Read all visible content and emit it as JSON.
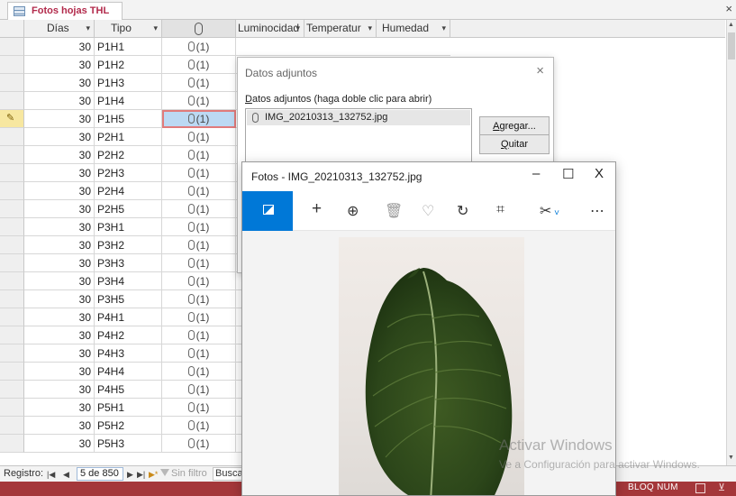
{
  "document_tab": {
    "title": "Fotos hojas THL",
    "close": "×"
  },
  "columns": [
    {
      "label": "Días",
      "dropdown": "▾"
    },
    {
      "label": "Tipo",
      "dropdown": "▾"
    },
    {
      "label": "",
      "icon": "paperclip-icon"
    },
    {
      "label": "Luminocidad",
      "dropdown": "▾"
    },
    {
      "label": "Temperatur",
      "dropdown": "▾"
    },
    {
      "label": "Humedad",
      "dropdown": "▾"
    }
  ],
  "rows": [
    {
      "dias": "30",
      "tipo": "P1H1",
      "adjuntos": "(1)"
    },
    {
      "dias": "30",
      "tipo": "P1H2",
      "adjuntos": "(1)"
    },
    {
      "dias": "30",
      "tipo": "P1H3",
      "adjuntos": "(1)"
    },
    {
      "dias": "30",
      "tipo": "P1H4",
      "adjuntos": "(1)"
    },
    {
      "dias": "30",
      "tipo": "P1H5",
      "adjuntos": "(1)"
    },
    {
      "dias": "30",
      "tipo": "P2H1",
      "adjuntos": "(1)"
    },
    {
      "dias": "30",
      "tipo": "P2H2",
      "adjuntos": "(1)"
    },
    {
      "dias": "30",
      "tipo": "P2H3",
      "adjuntos": "(1)"
    },
    {
      "dias": "30",
      "tipo": "P2H4",
      "adjuntos": "(1)"
    },
    {
      "dias": "30",
      "tipo": "P2H5",
      "adjuntos": "(1)"
    },
    {
      "dias": "30",
      "tipo": "P3H1",
      "adjuntos": "(1)"
    },
    {
      "dias": "30",
      "tipo": "P3H2",
      "adjuntos": "(1)"
    },
    {
      "dias": "30",
      "tipo": "P3H3",
      "adjuntos": "(1)"
    },
    {
      "dias": "30",
      "tipo": "P3H4",
      "adjuntos": "(1)"
    },
    {
      "dias": "30",
      "tipo": "P3H5",
      "adjuntos": "(1)"
    },
    {
      "dias": "30",
      "tipo": "P4H1",
      "adjuntos": "(1)"
    },
    {
      "dias": "30",
      "tipo": "P4H2",
      "adjuntos": "(1)"
    },
    {
      "dias": "30",
      "tipo": "P4H3",
      "adjuntos": "(1)"
    },
    {
      "dias": "30",
      "tipo": "P4H4",
      "adjuntos": "(1)"
    },
    {
      "dias": "30",
      "tipo": "P4H5",
      "adjuntos": "(1)"
    },
    {
      "dias": "30",
      "tipo": "P5H1",
      "adjuntos": "(1)"
    },
    {
      "dias": "30",
      "tipo": "P5H2",
      "adjuntos": "(1)"
    },
    {
      "dias": "30",
      "tipo": "P5H3",
      "adjuntos": "(1)"
    }
  ],
  "current_row": 4,
  "navigation": {
    "label": "Registro:",
    "first": "|◀",
    "prev": "◀",
    "record": "5 de 850",
    "next": "▶",
    "last": "▶|",
    "new": "▶*",
    "filter": "Sin filtro",
    "search": "Buscar"
  },
  "status_bar": {
    "caps": "BLOQ NUM"
  },
  "attachments_dialog": {
    "title": "Datos adjuntos",
    "close": "×",
    "list_label_prefix": "D",
    "list_label_rest": "atos adjuntos (haga doble clic para abrir)",
    "files": [
      "IMG_20210313_132752.jpg"
    ],
    "buttons": [
      {
        "prefix": "A",
        "rest": "gregar..."
      },
      {
        "prefix": "Q",
        "rest": "uitar"
      }
    ]
  },
  "photos_window": {
    "title": "Fotos - IMG_20210313_132752.jpg",
    "minimize": "–",
    "maximize": "☐",
    "close": "X",
    "toolbar": [
      "image-icon",
      "add-icon",
      "zoom-in-icon",
      "delete-icon",
      "favorite-icon",
      "rotate-icon",
      "crop-icon",
      "edit-icon",
      "more-icon"
    ],
    "colors": {
      "accent": "#0078d7"
    }
  },
  "watermark": {
    "title": "Activar Windows",
    "subtitle": "Ve a Configuración para activar Windows."
  },
  "colors": {
    "status_bar": "#a4373a",
    "tab_title": "#b22a4b",
    "selected_cell": "#bcd9f3"
  }
}
